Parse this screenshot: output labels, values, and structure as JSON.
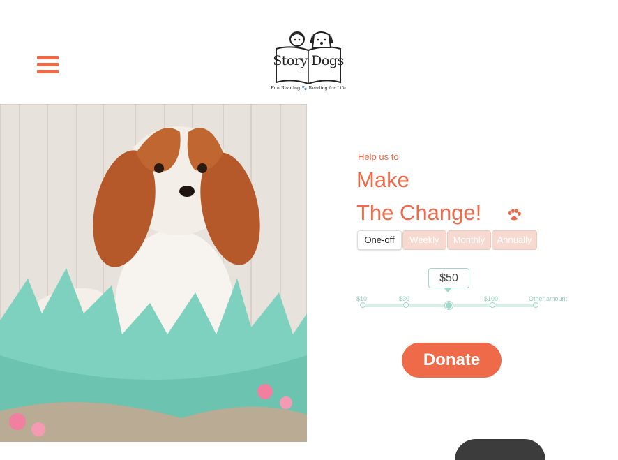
{
  "header": {
    "logo": {
      "title": "Story Dogs",
      "tagline": "Fun Reading 🐾 Reading for Life"
    },
    "menu_icon": "hamburger-menu-icon"
  },
  "hero": {
    "image": "puppy-in-easter-egg-photo"
  },
  "donation": {
    "intro": "Help us to",
    "headline_line1": "Make",
    "headline_line2": "The Change!",
    "paw_icon": "paw-icon",
    "frequency_tabs": [
      "One-off",
      "Weekly",
      "Monthly",
      "Annually"
    ],
    "selected_frequency": "One-off",
    "selected_amount": "$50",
    "amount_options": [
      "$10",
      "$30",
      "$50",
      "$100",
      "Other amount"
    ],
    "donate_label": "Donate"
  },
  "colors": {
    "brand_orange": "#ee6a49",
    "slider_mint": "#9ed8c8",
    "tab_inactive": "#f6d9d1"
  }
}
